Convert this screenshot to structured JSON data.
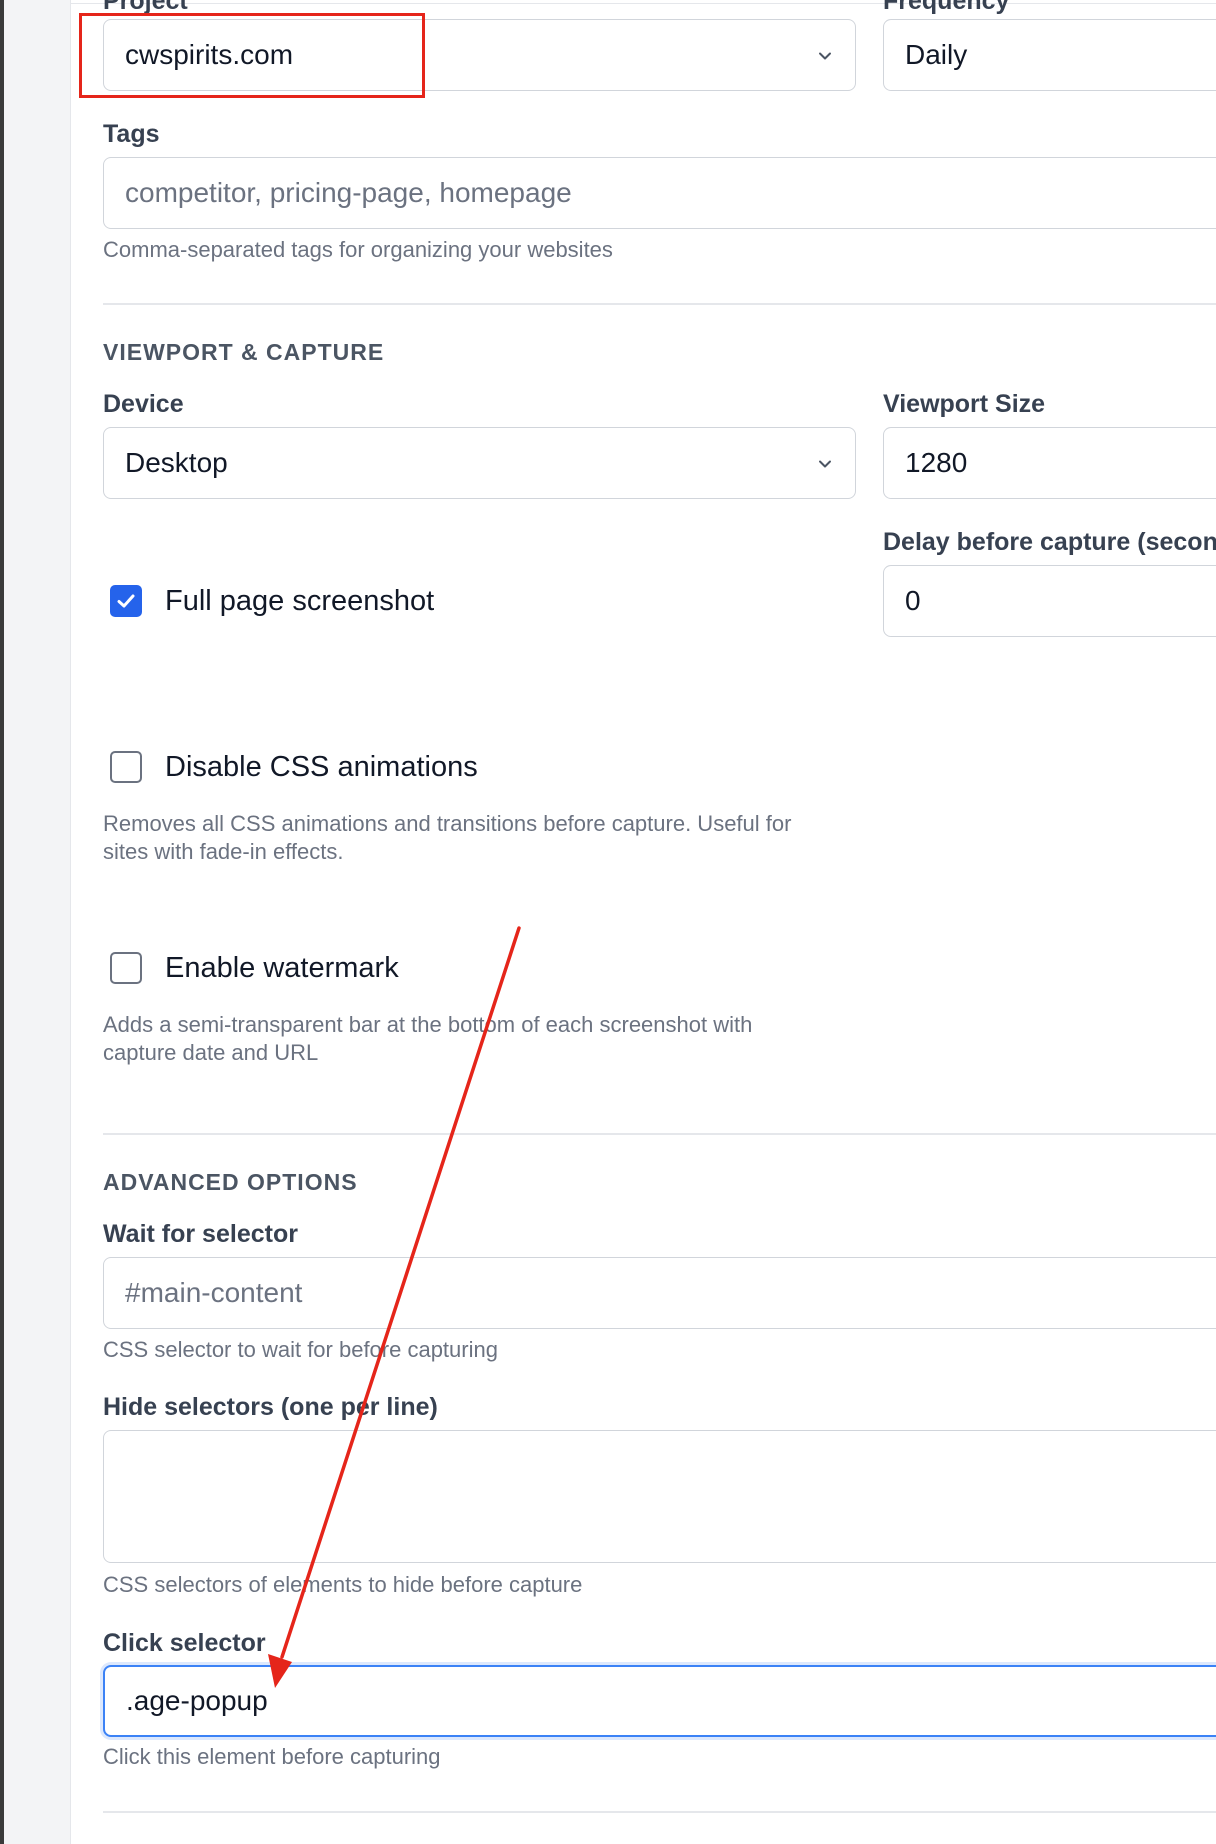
{
  "form": {
    "project": {
      "label": "Project",
      "value": "cwspirits.com",
      "icon": "chevron-down-icon"
    },
    "frequency": {
      "label": "Frequency",
      "value": "Daily"
    },
    "tags": {
      "label": "Tags",
      "placeholder": "competitor, pricing-page, homepage",
      "help": "Comma-separated tags for organizing your websites"
    }
  },
  "viewport": {
    "heading": "VIEWPORT & CAPTURE",
    "device": {
      "label": "Device",
      "value": "Desktop",
      "icon": "chevron-down-icon"
    },
    "viewport_size": {
      "label": "Viewport Size",
      "value": "1280"
    },
    "delay": {
      "label": "Delay before capture (seconds)",
      "value": "0"
    },
    "full_page": {
      "label": "Full page screenshot",
      "checked": true
    },
    "disable_css": {
      "label": "Disable CSS animations",
      "checked": false,
      "help_1": "Removes all CSS animations and transitions before capture. Useful for",
      "help_2": "sites with fade-in effects."
    },
    "watermark": {
      "label": "Enable watermark",
      "checked": false,
      "help_1": "Adds a semi-transparent bar at the bottom of each screenshot with",
      "help_2": "capture date and URL"
    }
  },
  "advanced": {
    "heading": "ADVANCED OPTIONS",
    "wait_selector": {
      "label": "Wait for selector",
      "placeholder": "#main-content",
      "help": "CSS selector to wait for before capturing"
    },
    "hide_selectors": {
      "label": "Hide selectors (one per line)",
      "value": "",
      "help": "CSS selectors of elements to hide before capture"
    },
    "click_selector": {
      "label": "Click selector",
      "value": ".age-popup",
      "help": "Click this element before capturing"
    }
  },
  "annotations": {
    "highlight_color": "#e5251a",
    "arrow_color": "#e5251a"
  }
}
